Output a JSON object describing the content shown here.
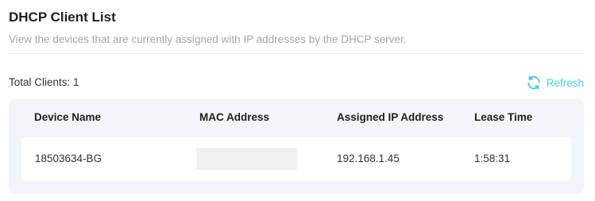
{
  "header": {
    "title": "DHCP Client List",
    "description": "View the devices that are currently assigned with IP addresses by the DHCP server."
  },
  "summary": {
    "total_label": "Total Clients: 1"
  },
  "actions": {
    "refresh_label": "Refresh",
    "refresh_icon": "refresh-icon",
    "accent_color": "#4acbd6"
  },
  "table": {
    "columns": [
      "Device Name",
      "MAC Address",
      "Assigned IP Address",
      "Lease Time"
    ],
    "rows": [
      {
        "device_name": "18503634-BG",
        "mac_address": "",
        "ip_address": "192.168.1.45",
        "lease_time": "1:58:31"
      }
    ]
  }
}
